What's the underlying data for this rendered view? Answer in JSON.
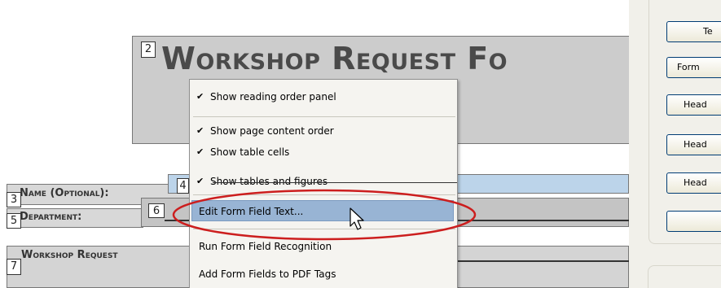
{
  "document": {
    "title": "Workshop Request Fo",
    "order_numbers": {
      "title": "2",
      "name": "3",
      "name_field": "4",
      "dept": "5",
      "dept_field": "6",
      "workshop": "7"
    },
    "labels": {
      "name": "Name (Optional):",
      "department": "Department:",
      "workshop": "Workshop Request"
    }
  },
  "context_menu": {
    "items": [
      {
        "label": "Show reading order panel",
        "checked": true
      },
      {
        "label": "Show page content order",
        "checked": true
      },
      {
        "label": "Show table cells",
        "checked": true
      },
      {
        "label": "Show tables and figures",
        "checked": true
      },
      {
        "label": "Edit Form Field Text...",
        "checked": false,
        "highlighted": true
      },
      {
        "label": "Run Form Field Recognition",
        "checked": false
      },
      {
        "label": "Add Form Fields to PDF Tags",
        "checked": false
      }
    ],
    "check_glyph": "✔"
  },
  "right_panel": {
    "buttons": [
      "Te",
      "Form",
      "Head",
      "Head",
      "Head",
      ""
    ]
  },
  "colors": {
    "highlight": "#98b4d4",
    "annotation_ellipse": "#cc1e1e",
    "block_gray": "#cccccc",
    "panel_bg": "#f1f0ea"
  },
  "icons": {
    "cursor": "mouse-pointer-icon",
    "check": "checkmark-icon"
  }
}
